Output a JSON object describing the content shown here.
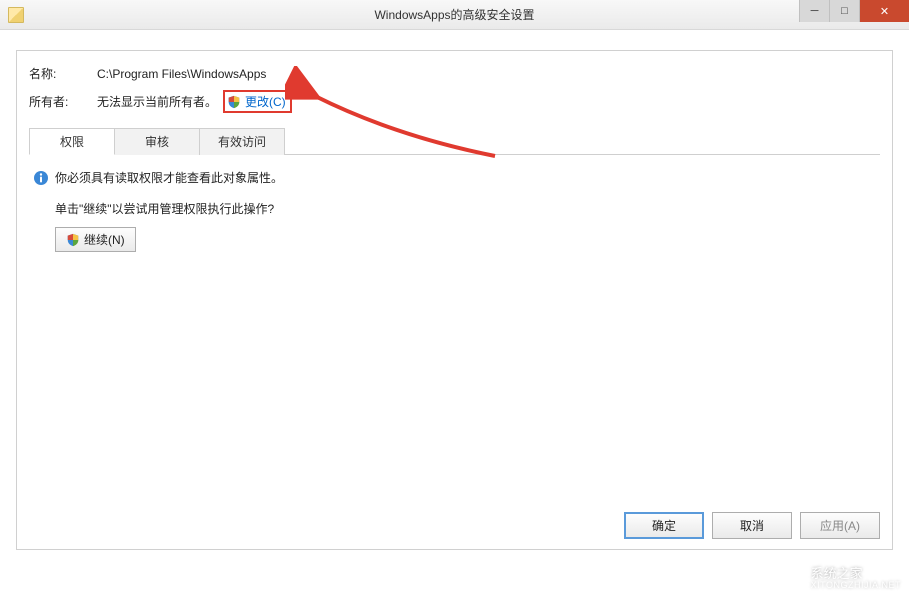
{
  "titlebar": {
    "title": "WindowsApps的高级安全设置"
  },
  "info": {
    "name_label": "名称:",
    "name_value": "C:\\Program Files\\WindowsApps",
    "owner_label": "所有者:",
    "owner_value": "无法显示当前所有者。",
    "change_link": "更改(C)"
  },
  "tabs": {
    "permissions": "权限",
    "audit": "审核",
    "effective": "有效访问"
  },
  "messages": {
    "need_read": "你必须具有读取权限才能查看此对象属性。",
    "click_continue": "单击\"继续\"以尝试用管理权限执行此操作?",
    "continue_btn": "继续(N)"
  },
  "footer": {
    "ok": "确定",
    "cancel": "取消",
    "apply": "应用(A)"
  },
  "watermark": {
    "text": "系统之家",
    "sub": "XITONGZHIJIA.NET"
  }
}
